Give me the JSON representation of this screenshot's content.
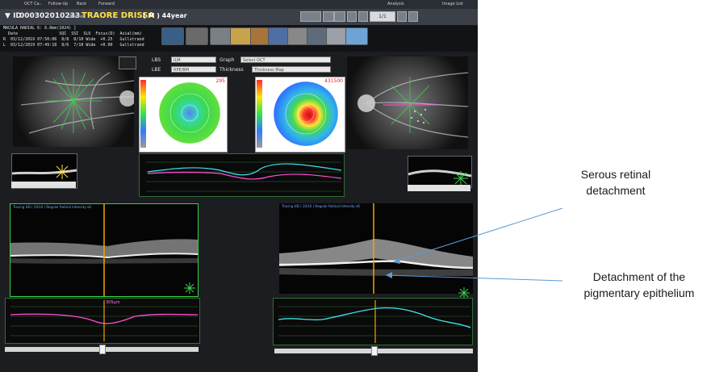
{
  "topbar": {
    "items": [
      "OCT Ca..",
      "Follow-Up",
      "Back",
      "Forward"
    ],
    "right_items": [
      "Analysis",
      "Image List"
    ]
  },
  "header": {
    "id_label": "ID",
    "id_value": "000302010233",
    "name_label": "Name",
    "name_value": "TRAORE DRISSA",
    "sex_age": "( M ) 44year",
    "counter": "1/1"
  },
  "scan_table": {
    "title_line": "MACULA RADIAL 6: 6.0mm(1024) ]",
    "columns": "  Date                 SQI  SSI  SLO  Focus(D)  Axial(mm)",
    "rows": [
      "R  03/12/2019 07:50:06  8/8  8/10 Wide  +0.25   Gullstrand",
      "L  03/12/2019 07:49:18  8/6  7/10 Wide  +0.00   Gullstrand"
    ]
  },
  "controls": {
    "lbs_label": "LBS",
    "lbs_value": "ILM",
    "lbe_label": "LBE",
    "lbe_value": "RPE/BM",
    "graph_label": "Graph",
    "graph_value": "Select OCT",
    "thickness_label": "Thickness",
    "thickness_value": "Thickness Map"
  },
  "maps": {
    "left_max": "295",
    "right_max": "431500"
  },
  "oct_labels": {
    "left": "Tracing HD ( 10/10 ) Regular Retinal Intensity x8",
    "right": "Tracing HD ( 10/10 ) Regular Retinal Intensity x8"
  },
  "marker_value": "305μm",
  "annotations": {
    "serous": [
      "Serous retinal",
      "detachment"
    ],
    "ped": [
      "Detachment of the",
      "pigmentary epithelium"
    ]
  },
  "colors": {
    "accent_yellow": "#ffe24a",
    "arrow_blue": "#5b9bd5",
    "trace_cyan": "#41e0e8",
    "trace_magenta": "#ff4fd8",
    "guide_orange": "#f2a400"
  }
}
